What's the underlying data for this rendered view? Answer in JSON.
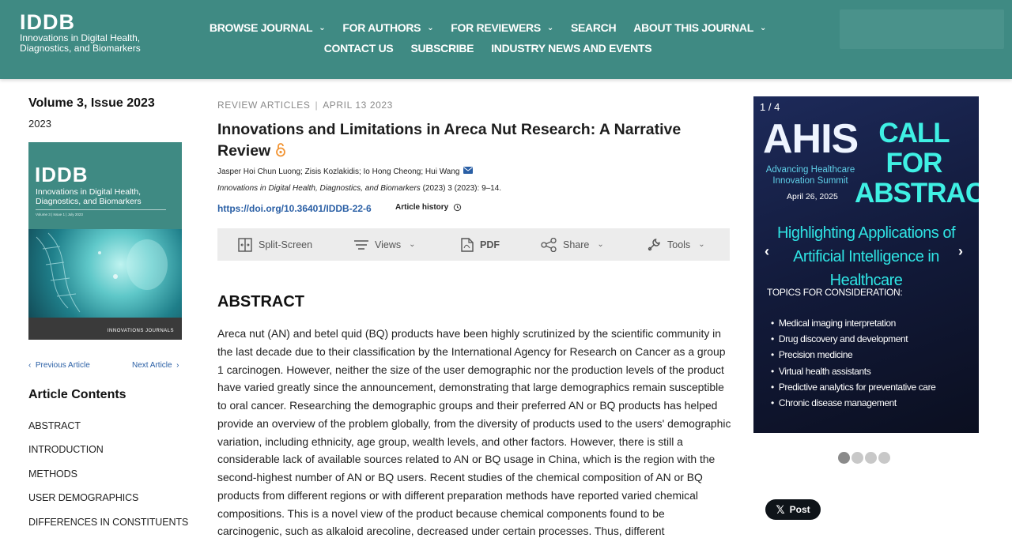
{
  "header": {
    "logo_title": "IDDB",
    "logo_sub_line1": "Innovations in Digital Health,",
    "logo_sub_line2": "Diagnostics, and Biomarkers",
    "nav": [
      {
        "label": "BROWSE JOURNAL",
        "has_dropdown": true
      },
      {
        "label": "FOR AUTHORS",
        "has_dropdown": true
      },
      {
        "label": "FOR REVIEWERS",
        "has_dropdown": true
      },
      {
        "label": "SEARCH",
        "has_dropdown": false
      },
      {
        "label": "ABOUT THIS JOURNAL",
        "has_dropdown": true
      },
      {
        "label": "CONTACT US",
        "has_dropdown": false
      },
      {
        "label": "SUBSCRIBE",
        "has_dropdown": false
      },
      {
        "label": "INDUSTRY NEWS AND EVENTS",
        "has_dropdown": false
      }
    ],
    "bg_color": "#3f8a83"
  },
  "sidebar": {
    "volume_title": "Volume 3, Issue 2023",
    "volume_year": "2023",
    "cover": {
      "title": "IDDB",
      "sub_line1": "Innovations in Digital Health,",
      "sub_line2": "Diagnostics, and Biomarkers",
      "meta": "Volume 3 | Issue 1 | July 2023",
      "brand": "INNOVATIONS JOURNALS"
    },
    "prev_label": "Previous Article",
    "next_label": "Next Article",
    "contents_title": "Article Contents",
    "toc": [
      "ABSTRACT",
      "INTRODUCTION",
      "METHODS",
      "USER DEMOGRAPHICS",
      "DIFFERENCES IN CONSTITUENTS"
    ]
  },
  "article": {
    "category": "REVIEW ARTICLES",
    "separator": "|",
    "date": "APRIL 13 2023",
    "title": "Innovations and Limitations in Areca Nut Research: A Narrative Review",
    "authors": "Jasper Hoi Chun Luong; Zisis Kozlakidis; Io Hong Cheong; Hui Wang",
    "citation_journal": "Innovations in Digital Health, Diagnostics, and Biomarkers",
    "citation_rest": " (2023) 3 (2023): 9–14.",
    "doi": "https://doi.org/10.36401/IDDB-22-6",
    "history_label": "Article history",
    "toolbar": {
      "split_screen": "Split-Screen",
      "views": "Views",
      "pdf": "PDF",
      "share": "Share",
      "tools": "Tools"
    },
    "abstract_heading": "ABSTRACT",
    "abstract_text": "Areca nut (AN) and betel quid (BQ) products have been highly scrutinized by the scientific community in the last decade due to their classification by the International Agency for Research on Cancer as a group 1 carcinogen. However, neither the size of the user demographic nor the production levels of the product have varied greatly since the announcement, demonstrating that large demographics remain susceptible to oral cancer. Researching the demographic groups and their preferred AN or BQ products has helped provide an overview of the problem globally, from the diversity of products used to the users' demographic variation, including ethnicity, age group, wealth levels, and other factors. However, there is still a considerable lack of available sources related to AN or BQ usage in China, which is the region with the second-highest number of AN or BQ users. Recent studies of the chemical composition of AN or BQ products from different regions or with different preparation methods have reported varied chemical compositions. This is a novel view of the product because chemical components found to be carcinogenic, such as alkaloid arecoline, decreased under certain processes. Thus, different"
  },
  "ad": {
    "counter": "1 / 4",
    "ahis": "AHIS",
    "ahis_sub": "Advancing Healthcare Innovation Summit",
    "date": "April 26, 2025",
    "call": "CALL FOR ABSTRACTS",
    "highlight": "Highlighting Applications of Artificial Intelligence in Healthcare",
    "topics_title": "TOPICS FOR CONSIDERATION:",
    "topics": [
      "Medical imaging interpretation",
      "Drug discovery and development",
      "Precision medicine",
      "Virtual health assistants",
      "Predictive analytics for preventative care",
      "Chronic disease management"
    ],
    "prev_arrow": "‹",
    "next_arrow": "›",
    "dot_count": 4,
    "active_dot": 1
  },
  "social": {
    "post_label": "Post"
  }
}
